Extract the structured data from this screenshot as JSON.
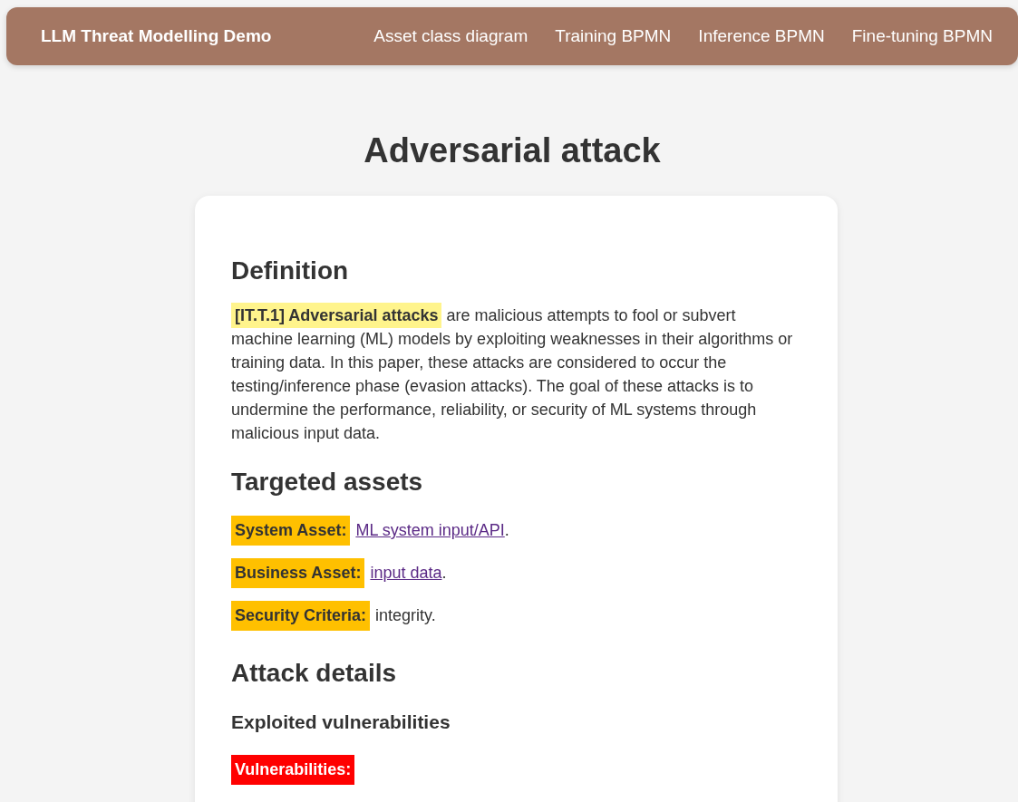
{
  "navbar": {
    "brand": "LLM Threat Modelling Demo",
    "links": [
      "Asset class diagram",
      "Training BPMN",
      "Inference BPMN",
      "Fine-tuning BPMN"
    ]
  },
  "page_title": "Adversarial attack",
  "definition": {
    "heading": "Definition",
    "term": "[IT.T.1] Adversarial attacks",
    "text": "are malicious attempts to fool or subvert machine learning (ML) models by exploiting weaknesses in their algorithms or training data. In this paper, these attacks are considered to occur the testing/inference phase (evasion attacks). The goal of these attacks is to undermine the performance, reliability, or security of ML systems through malicious input data."
  },
  "targeted_assets": {
    "heading": "Targeted assets",
    "items": [
      {
        "label": "System Asset:",
        "kind": "link",
        "value": "ML system input/API",
        "suffix": "."
      },
      {
        "label": "Business Asset:",
        "kind": "link",
        "value": "input data",
        "suffix": "."
      },
      {
        "label": "Security Criteria:",
        "kind": "text",
        "value": "integrity."
      }
    ]
  },
  "attack_details": {
    "heading": "Attack details",
    "subheading": "Exploited vulnerabilities",
    "vulnerabilities_label": "Vulnerabilities:"
  }
}
